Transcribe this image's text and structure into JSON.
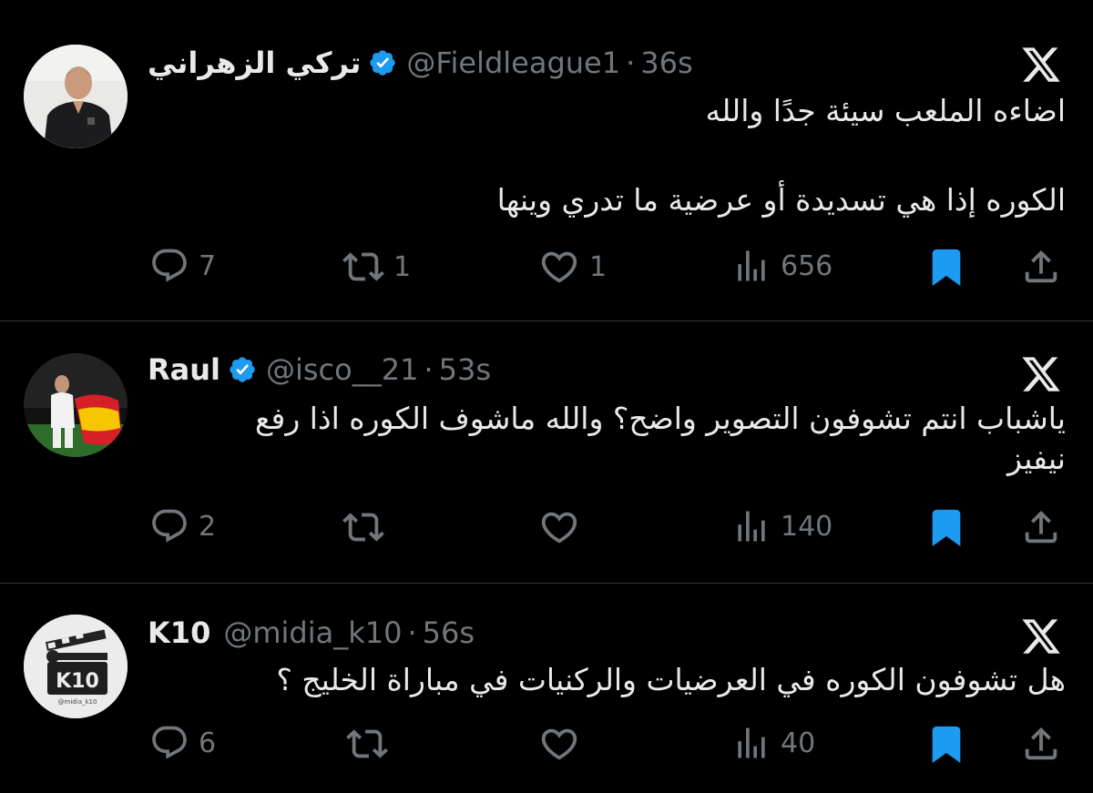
{
  "colors": {
    "background": "#000000",
    "text": "#e7e9ea",
    "muted": "#71767b",
    "accent": "#1d9bf0",
    "divider": "#2f3336"
  },
  "icons": {
    "reply": "reply-icon",
    "retweet": "retweet-icon",
    "like": "like-icon",
    "views": "views-icon",
    "bookmark": "bookmark-filled-icon",
    "share": "share-icon",
    "platform": "x-logo-icon",
    "verified": "verified-badge-icon"
  },
  "tweets": [
    {
      "name": "تركي الزهراني",
      "verified": true,
      "handle": "@Fieldleague1",
      "separator": "·",
      "time": "36s",
      "text_lines": [
        "اضاءه الملعب سيئة جدًا والله",
        "",
        "الكوره إذا هي تسديدة أو عرضية ما تدري وينها"
      ],
      "replies": "7",
      "retweets": "1",
      "likes": "1",
      "views": "656",
      "bookmarked": true
    },
    {
      "name": "Raul",
      "verified": true,
      "handle": "@isco__21",
      "separator": "·",
      "time": "53s",
      "text_lines": [
        "ياشباب انتم تشوفون التصوير واضح؟ والله ماشوف الكوره اذا رفع",
        "نيفيز"
      ],
      "replies": "2",
      "retweets": "",
      "likes": "",
      "views": "140",
      "bookmarked": true
    },
    {
      "name": "K10",
      "verified": false,
      "handle": "@midia_k10",
      "separator": "·",
      "time": "56s",
      "text_lines": [
        "هل تشوفون الكوره في العرضيات والركنيات في مباراة الخليج ؟"
      ],
      "replies": "6",
      "retweets": "",
      "likes": "",
      "views": "40",
      "bookmarked": true,
      "avatar_logo_text": "K10",
      "avatar_logo_subtext": "@midia_k10"
    }
  ]
}
